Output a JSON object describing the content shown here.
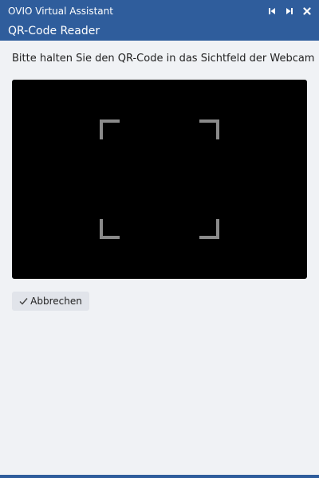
{
  "window": {
    "title": "OVIO Virtual Assistant",
    "controls": [
      {
        "name": "skip-previous-icon"
      },
      {
        "name": "skip-next-icon"
      },
      {
        "name": "close-icon"
      }
    ]
  },
  "header": {
    "title": "QR-Code Reader"
  },
  "main": {
    "instruction": "Bitte halten Sie den QR-Code in das Sichtfeld der Webcam",
    "camera": {
      "background": "#000000",
      "frame_color": "#8a8a8a",
      "scan_line_color": "#cc0000"
    },
    "cancel_button": {
      "label": "Abbrechen",
      "icon": "check-icon"
    }
  },
  "colors": {
    "accent": "#2f5d9c",
    "page_background": "#f0f2f5",
    "button_background": "#e1e4ea"
  }
}
